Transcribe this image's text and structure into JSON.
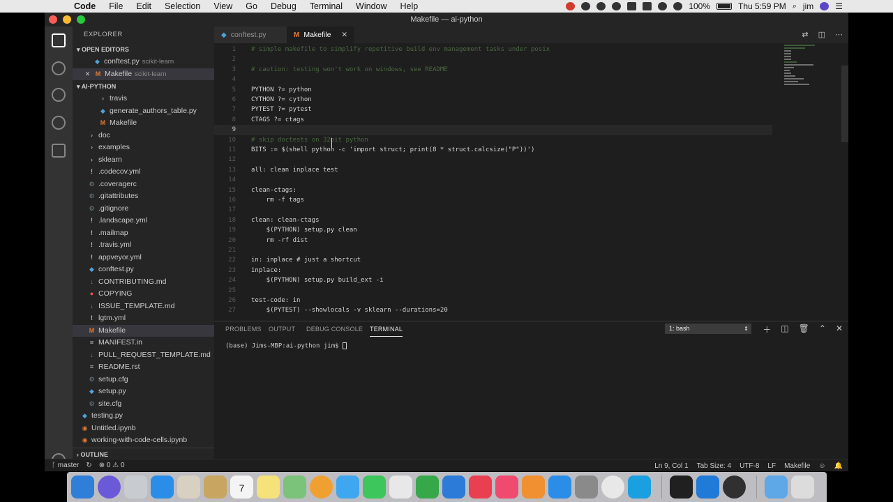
{
  "menubar": {
    "app_name": "Code",
    "items": [
      "File",
      "Edit",
      "Selection",
      "View",
      "Go",
      "Debug",
      "Terminal",
      "Window",
      "Help"
    ],
    "battery": "100%",
    "clock": "Thu 5:59 PM",
    "user": "jim"
  },
  "window": {
    "title": "Makefile — ai-python"
  },
  "sidebar": {
    "header": "EXPLORER",
    "open_editors_label": "OPEN EDITORS",
    "open_editors": [
      {
        "name": "conftest.py",
        "desc": "scikit-learn"
      },
      {
        "name": "Makefile",
        "desc": "scikit-learn"
      }
    ],
    "folder_label": "AI-PYTHON",
    "tree": [
      {
        "name": "travis",
        "type": "fold"
      },
      {
        "name": "generate_authors_table.py",
        "type": "py"
      },
      {
        "name": "Makefile",
        "type": "mk"
      },
      {
        "name": "doc",
        "type": "fold"
      },
      {
        "name": "examples",
        "type": "fold"
      },
      {
        "name": "sklearn",
        "type": "fold"
      },
      {
        "name": ".codecov.yml",
        "type": "ex"
      },
      {
        "name": ".coveragerc",
        "type": "gear"
      },
      {
        "name": ".gitattributes",
        "type": "gear"
      },
      {
        "name": ".gitignore",
        "type": "gear"
      },
      {
        "name": ".landscape.yml",
        "type": "ex"
      },
      {
        "name": ".mailmap",
        "type": "ex"
      },
      {
        "name": ".travis.yml",
        "type": "ex"
      },
      {
        "name": "appveyor.yml",
        "type": "ex"
      },
      {
        "name": "conftest.py",
        "type": "py"
      },
      {
        "name": "CONTRIBUTING.md",
        "type": "md"
      },
      {
        "name": "COPYING",
        "type": "red"
      },
      {
        "name": "ISSUE_TEMPLATE.md",
        "type": "md"
      },
      {
        "name": "lgtm.yml",
        "type": "ex"
      },
      {
        "name": "Makefile",
        "type": "mk",
        "selected": true
      },
      {
        "name": "MANIFEST.in",
        "type": "rst"
      },
      {
        "name": "PULL_REQUEST_TEMPLATE.md",
        "type": "md"
      },
      {
        "name": "README.rst",
        "type": "rst"
      },
      {
        "name": "setup.cfg",
        "type": "gear"
      },
      {
        "name": "setup.py",
        "type": "py"
      },
      {
        "name": "site.cfg",
        "type": "gear"
      },
      {
        "name": "testing.py",
        "type": "py"
      },
      {
        "name": "Untitled.ipynb",
        "type": "nb"
      },
      {
        "name": "working-with-code-cells.ipynb",
        "type": "nb"
      }
    ],
    "outline_label": "OUTLINE",
    "settings_badge": "1"
  },
  "tabs": [
    {
      "label": "conftest.py",
      "active": false
    },
    {
      "label": "Makefile",
      "active": true
    }
  ],
  "editor": {
    "current_line": 9,
    "lines": [
      {
        "n": "1",
        "text": "# simple makefile to simplify repetitive build env management tasks under posix",
        "kind": "cm"
      },
      {
        "n": "2",
        "text": "",
        "kind": ""
      },
      {
        "n": "3",
        "text": "# caution: testing won't work on windows, see README",
        "kind": "cm"
      },
      {
        "n": "4",
        "text": "",
        "kind": ""
      },
      {
        "n": "5",
        "text": "PYTHON ?= python",
        "kind": ""
      },
      {
        "n": "6",
        "text": "CYTHON ?= cython",
        "kind": ""
      },
      {
        "n": "7",
        "text": "PYTEST ?= pytest",
        "kind": ""
      },
      {
        "n": "8",
        "text": "CTAGS ?= ctags",
        "kind": ""
      },
      {
        "n": "9",
        "text": "",
        "kind": ""
      },
      {
        "n": "10",
        "text": "# skip doctests on 32bit python",
        "kind": "cm"
      },
      {
        "n": "11",
        "text": "BITS := $(shell python -c 'import struct; print(8 * struct.calcsize(\"P\"))')",
        "kind": ""
      },
      {
        "n": "12",
        "text": "",
        "kind": ""
      },
      {
        "n": "13",
        "text": "all: clean inplace test",
        "kind": ""
      },
      {
        "n": "14",
        "text": "",
        "kind": ""
      },
      {
        "n": "15",
        "text": "clean-ctags:",
        "kind": ""
      },
      {
        "n": "16",
        "text": "    rm -f tags",
        "kind": ""
      },
      {
        "n": "17",
        "text": "",
        "kind": ""
      },
      {
        "n": "18",
        "text": "clean: clean-ctags",
        "kind": ""
      },
      {
        "n": "19",
        "text": "    $(PYTHON) setup.py clean",
        "kind": ""
      },
      {
        "n": "20",
        "text": "    rm -rf dist",
        "kind": ""
      },
      {
        "n": "21",
        "text": "",
        "kind": ""
      },
      {
        "n": "22",
        "text": "in: inplace # just a shortcut",
        "kind": ""
      },
      {
        "n": "23",
        "text": "inplace:",
        "kind": ""
      },
      {
        "n": "24",
        "text": "    $(PYTHON) setup.py build_ext -i",
        "kind": ""
      },
      {
        "n": "25",
        "text": "",
        "kind": ""
      },
      {
        "n": "26",
        "text": "test-code: in",
        "kind": ""
      },
      {
        "n": "27",
        "text": "    $(PYTEST) --showlocals -v sklearn --durations=20",
        "kind": ""
      }
    ]
  },
  "panel": {
    "tabs": [
      "PROBLEMS",
      "OUTPUT",
      "DEBUG CONSOLE",
      "TERMINAL"
    ],
    "active_tab": "TERMINAL",
    "terminal_select": "1: bash",
    "prompt": "(base) Jims-MBP:ai-python jim$"
  },
  "statusbar": {
    "branch": "master",
    "errors": "0",
    "warnings": "0",
    "position": "Ln 9, Col 1",
    "tab_size": "Tab Size: 4",
    "encoding": "UTF-8",
    "eol": "LF",
    "language": "Makefile"
  },
  "dock": {
    "calendar_day": "7",
    "apps": [
      "finder-icon",
      "siri-icon",
      "launchpad-icon",
      "safari-icon",
      "preview-icon",
      "folder-icon",
      "calendar-icon",
      "notes-icon",
      "maps-icon",
      "photos-icon",
      "messages-icon",
      "facetime-icon",
      "sketchbook-icon",
      "numbers-icon",
      "keynote-icon",
      "news-icon",
      "music-icon",
      "books-icon",
      "app-store-icon",
      "system-preferences-icon",
      "chrome-icon",
      "skype-icon",
      "terminal-icon",
      "vscode-icon",
      "obs-icon",
      "downloads-folder-icon",
      "trash-icon"
    ]
  }
}
